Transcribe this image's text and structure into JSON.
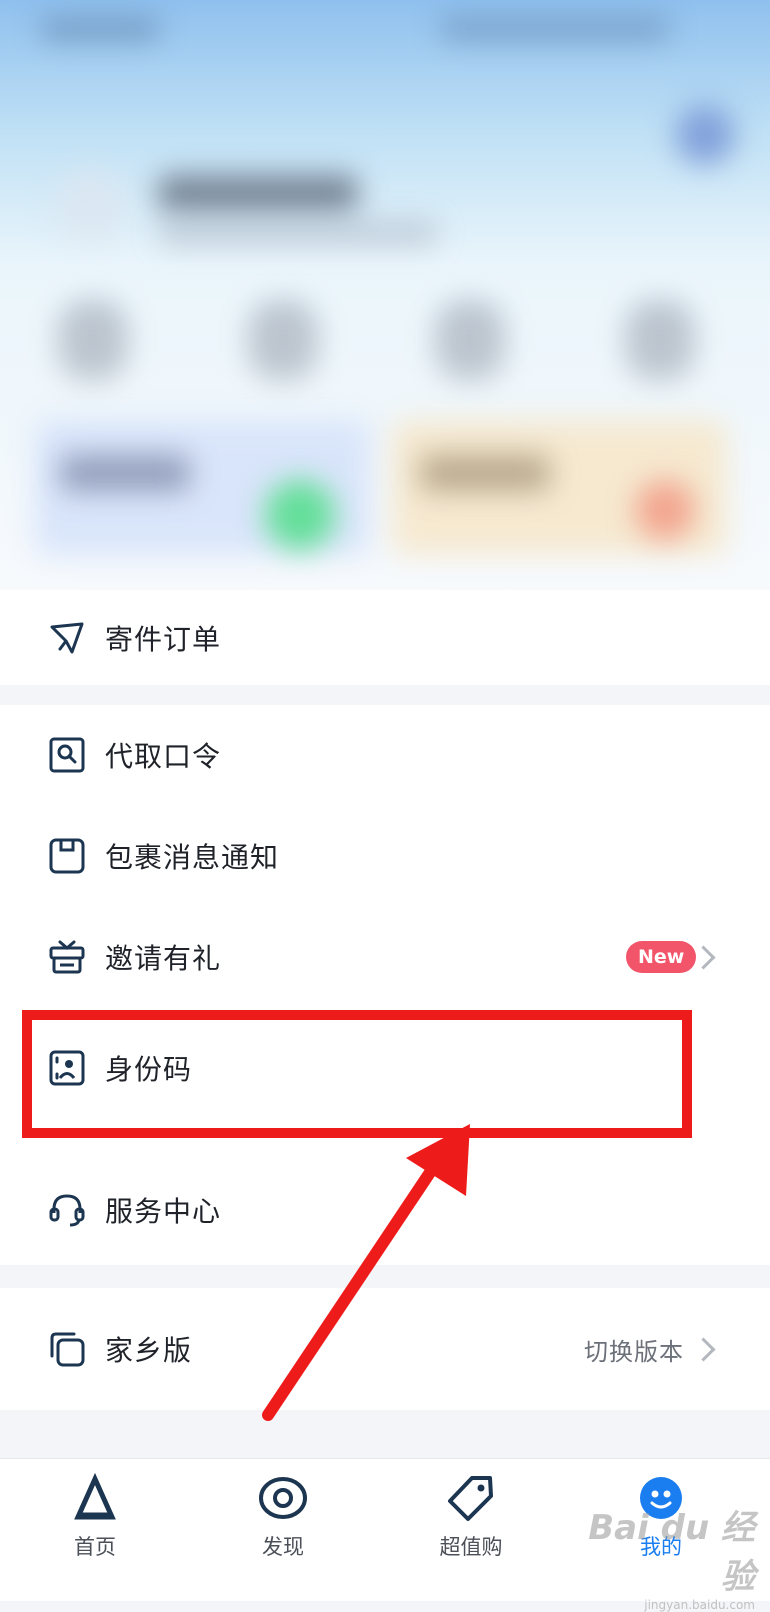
{
  "menu": {
    "send_orders": {
      "label": "寄件订单",
      "icon": "paper-plane-icon"
    },
    "pickup_code": {
      "label": "代取口令",
      "icon": "search-card-icon"
    },
    "package_notify": {
      "label": "包裹消息通知",
      "icon": "message-box-icon"
    },
    "invite": {
      "label": "邀请有礼",
      "icon": "gift-box-icon",
      "badge": "New"
    },
    "id_code": {
      "label": "身份码",
      "icon": "id-scan-icon"
    },
    "service": {
      "label": "服务中心",
      "icon": "headset-icon"
    },
    "hometown": {
      "label": "家乡版",
      "icon": "copy-icon",
      "action": "切换版本"
    }
  },
  "tabs": [
    {
      "label": "首页",
      "icon": "home-logo-icon"
    },
    {
      "label": "发现",
      "icon": "eye-icon"
    },
    {
      "label": "超值购",
      "icon": "tag-icon"
    },
    {
      "label": "我的",
      "icon": "profile-icon",
      "active": true
    }
  ],
  "colors": {
    "accent": "#1a7df0",
    "badge": "#f2556a",
    "highlight": "#ee1b1b",
    "icon_dark": "#1c3550"
  },
  "watermark": {
    "main": "Bai du 经验",
    "sub": "jingyan.baidu.com"
  }
}
